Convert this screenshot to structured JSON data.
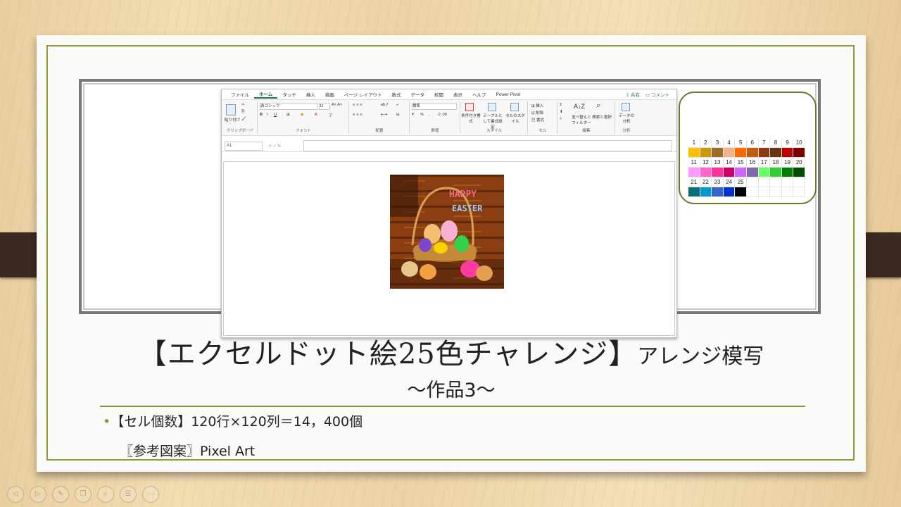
{
  "ribbon": {
    "tabs": [
      "ファイル",
      "ホーム",
      "タッチ",
      "挿入",
      "描画",
      "ページ レイアウト",
      "数式",
      "データ",
      "校閲",
      "表示",
      "ヘルプ",
      "Power Pivot"
    ],
    "active_tab": "ホーム",
    "share": "共有",
    "comment": "コメント",
    "groups": {
      "clipboard": "クリップボード",
      "font": "フォント",
      "alignment": "配置",
      "number": "数値",
      "styles": "スタイル",
      "cells": "セル",
      "editing": "編集",
      "analysis": "分析"
    },
    "paste": "貼り付け",
    "font_name": "游ゴシック",
    "font_size": "11",
    "number_format": "標準",
    "cond_format": "条件付き書式",
    "table_format": "テーブルとして書式設定",
    "cell_style": "セルのスタイル",
    "insert": "挿入",
    "delete": "削除",
    "format": "書式",
    "sort_filter": "並べ替えとフィルター",
    "find_select": "検索と選択",
    "data_analysis": "データの分析"
  },
  "formula_bar": {
    "name_box": "A1",
    "fx": "fx"
  },
  "artwork": {
    "line1": "HAPPY",
    "line2": "EASTER"
  },
  "palette": {
    "rows": [
      {
        "numbers": [
          "1",
          "2",
          "3",
          "4",
          "5",
          "6",
          "7",
          "8",
          "9",
          "10"
        ],
        "colors": [
          "#ffc000",
          "#c99a06",
          "#9c6b2c",
          "#f4b183",
          "#ff6a00",
          "#c55a11",
          "#8b3c12",
          "#6b3410",
          "#c00000",
          "#7b0000"
        ]
      },
      {
        "numbers": [
          "11",
          "12",
          "13",
          "14",
          "15",
          "16",
          "17",
          "18",
          "19",
          "20"
        ],
        "colors": [
          "#ff99ff",
          "#ff66cc",
          "#ff3399",
          "#cc0066",
          "#cc66ff",
          "#7f6aa8",
          "#66ff66",
          "#33cc33",
          "#008000",
          "#004d00"
        ]
      },
      {
        "numbers": [
          "21",
          "22",
          "23",
          "24",
          "25",
          "",
          "",
          "",
          "",
          ""
        ],
        "colors": [
          "#00707a",
          "#0099cc",
          "#3366cc",
          "#0033cc",
          "#000000",
          "",
          "",
          "",
          "",
          ""
        ]
      }
    ]
  },
  "slide": {
    "title_main": "【エクセルドット絵25色チャレンジ】",
    "title_suffix": "アレンジ模写",
    "subtitle": "～作品3～",
    "bullet": "【セル個数】120行×120列＝14，400個",
    "reference": "〖参考図案〗Pixel Art"
  },
  "nav": [
    "◁",
    "▷",
    "✎",
    "❐",
    "⌕",
    "☰",
    "⋯"
  ]
}
